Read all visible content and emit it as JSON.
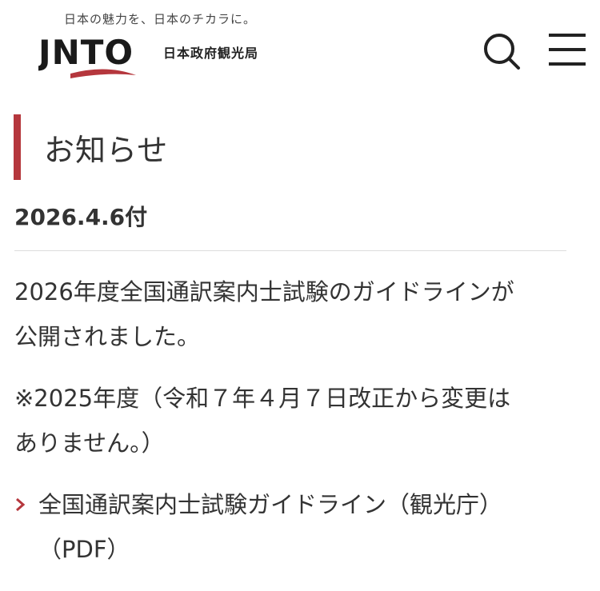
{
  "header": {
    "tagline": "日本の魅力を、日本のチカラに。",
    "logo_text": "JNTO",
    "org_name": "日本政府観光局",
    "search_icon": "search-icon",
    "menu_icon": "hamburger-menu-icon"
  },
  "colors": {
    "accent": "#b5373d",
    "text": "#333333",
    "divider": "#dcdcdc"
  },
  "main": {
    "heading": "お知らせ",
    "date": "2026.4.6付",
    "paragraph1_line1": "2026年度全国通訳案内士試験のガイドラインが",
    "paragraph1_line2": "公開されました。",
    "paragraph2_line1": "※2025年度（令和７年４月７日改正から変更は",
    "paragraph2_line2": "ありません。）",
    "link": {
      "icon": "chevron-right-icon",
      "line1": "全国通訳案内士試験ガイドライン（観光庁）",
      "line2": "（PDF）"
    }
  }
}
